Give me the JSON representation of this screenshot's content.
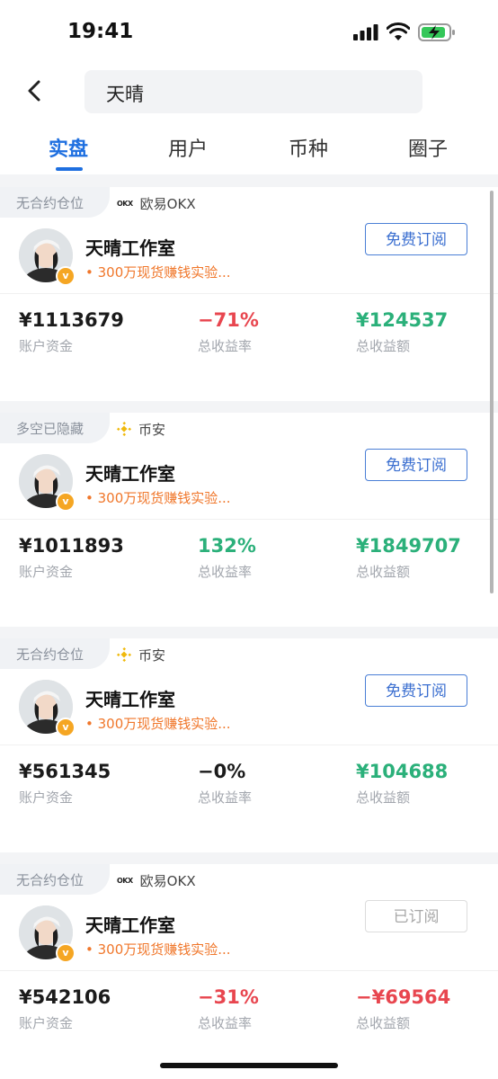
{
  "status_bar": {
    "time": "19:41"
  },
  "header": {
    "search_value": "天晴"
  },
  "tabs": [
    {
      "label": "实盘",
      "active": true
    },
    {
      "label": "用户",
      "active": false
    },
    {
      "label": "币种",
      "active": false
    },
    {
      "label": "圈子",
      "active": false
    }
  ],
  "colors": {
    "accent": "#1e6fe0",
    "profit": "#2bb07a",
    "loss": "#e8464f",
    "desc": "#f0772b"
  },
  "cards": [
    {
      "position_tag": "无合约仓位",
      "exchange_logo": "okx-logo",
      "exchange_logo_text": "OKX",
      "exchange": "欧易OKX",
      "name": "天晴工作室",
      "desc": "• 300万现货赚钱实验...",
      "button": "免费订阅",
      "subscribed": false,
      "account_value": "¥1113679",
      "account_label": "账户资金",
      "return_rate": "−71%",
      "return_label": "总收益率",
      "profit": "¥124537",
      "profit_label": "总收益额"
    },
    {
      "position_tag": "多空已隐藏",
      "exchange_logo": "binance-logo",
      "exchange": "币安",
      "name": "天晴工作室",
      "desc": "• 300万现货赚钱实验...",
      "button": "免费订阅",
      "subscribed": false,
      "account_value": "¥1011893",
      "account_label": "账户资金",
      "return_rate": "132%",
      "return_label": "总收益率",
      "profit": "¥1849707",
      "profit_label": "总收益额"
    },
    {
      "position_tag": "无合约仓位",
      "exchange_logo": "binance-logo",
      "exchange": "币安",
      "name": "天晴工作室",
      "desc": "• 300万现货赚钱实验...",
      "button": "免费订阅",
      "subscribed": false,
      "account_value": "¥561345",
      "account_label": "账户资金",
      "return_rate": "−0%",
      "return_label": "总收益率",
      "profit": "¥104688",
      "profit_label": "总收益额"
    },
    {
      "position_tag": "无合约仓位",
      "exchange_logo": "okx-logo",
      "exchange_logo_text": "OKX",
      "exchange": "欧易OKX",
      "name": "天晴工作室",
      "desc": "• 300万现货赚钱实验...",
      "button": "已订阅",
      "subscribed": true,
      "account_value": "¥542106",
      "account_label": "账户资金",
      "return_rate": "−31%",
      "return_label": "总收益率",
      "profit": "−¥69564",
      "profit_label": "总收益额"
    }
  ]
}
